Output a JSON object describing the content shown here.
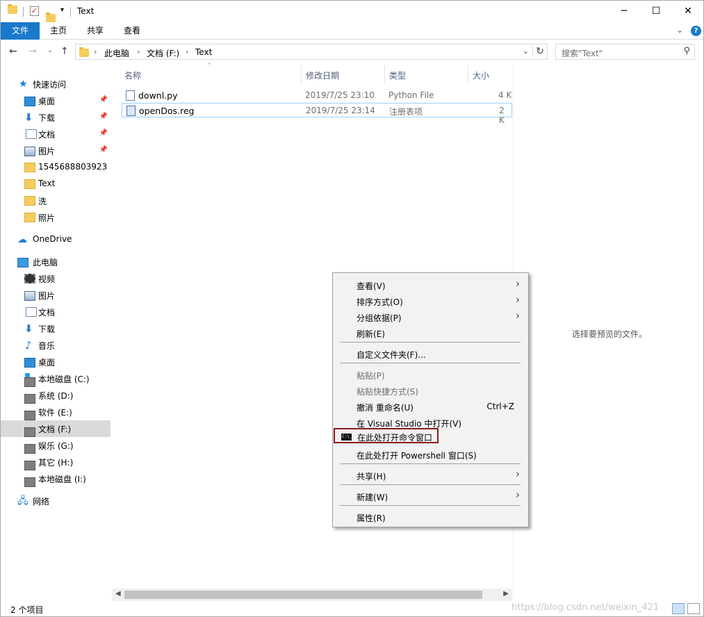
{
  "window": {
    "title": "Text"
  },
  "ribbon": {
    "tabs": [
      "文件",
      "主页",
      "共享",
      "查看"
    ]
  },
  "address": {
    "segments": [
      "此电脑",
      "文档 (F:)",
      "Text"
    ]
  },
  "search": {
    "placeholder": "搜索\"Text\""
  },
  "sidebar": {
    "quick_access": "快速访问",
    "quick_items": [
      "桌面",
      "下载",
      "文档",
      "图片",
      "1545688803923",
      "Text",
      "洗",
      "照片"
    ],
    "onedrive": "OneDrive",
    "this_pc": "此电脑",
    "pc_items": [
      "视频",
      "图片",
      "文档",
      "下载",
      "音乐",
      "桌面",
      "本地磁盘 (C:)",
      "系统 (D:)",
      "软件 (E:)",
      "文档 (F:)",
      "娱乐 (G:)",
      "其它 (H:)",
      "本地磁盘 (I:)"
    ],
    "network": "网络"
  },
  "columns": {
    "name": "名称",
    "date": "修改日期",
    "type": "类型",
    "size": "大小"
  },
  "files": [
    {
      "name": "downl.py",
      "date": "2019/7/25 23:10",
      "type": "Python File",
      "size": "4 K"
    },
    {
      "name": "openDos.reg",
      "date": "2019/7/25 23:14",
      "type": "注册表项",
      "size": "2 K"
    }
  ],
  "preview": {
    "message": "选择要预览的文件。"
  },
  "status": {
    "count": "2 个项目",
    "watermark": "https://blog.csdn.net/weixin_421"
  },
  "context_menu": {
    "items": [
      {
        "label": "查看(V)"
      },
      {
        "label": "排序方式(O)"
      },
      {
        "label": "分组依据(P)"
      },
      {
        "label": "刷新(E)"
      },
      {
        "label": "自定义文件夹(F)..."
      },
      {
        "label": "粘贴(P)"
      },
      {
        "label": "粘贴快捷方式(S)"
      },
      {
        "label": "撤消 重命名(U)",
        "shortcut": "Ctrl+Z"
      },
      {
        "label": "在 Visual Studio 中打开(V)"
      },
      {
        "label": "在此处打开命令窗口"
      },
      {
        "label": "在此处打开 Powershell 窗口(S)"
      },
      {
        "label": "共享(H)"
      },
      {
        "label": "新建(W)"
      },
      {
        "label": "属性(R)"
      }
    ]
  },
  "colors": {
    "accent": "#1979ca",
    "highlight_border": "#8b1a1a",
    "selection": "#d9d9d9"
  }
}
